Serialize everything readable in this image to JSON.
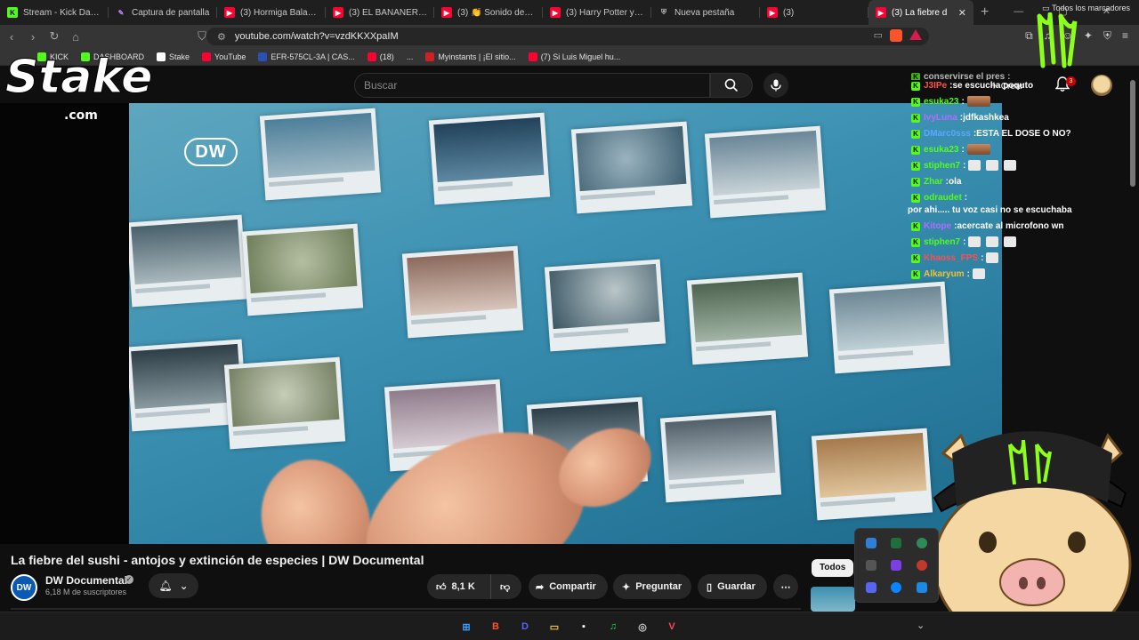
{
  "browser": {
    "tabs": [
      {
        "title": "Stream - Kick Dashbo",
        "icon": "kick-icon",
        "active": false
      },
      {
        "title": "Captura de pantalla",
        "icon": "pen-icon",
        "active": false
      },
      {
        "title": "(3) Hormiga Bala | Do",
        "icon": "youtube-icon",
        "active": false
      },
      {
        "title": "(3) EL BANANERO - I",
        "icon": "youtube-icon",
        "active": false
      },
      {
        "title": "(3) 👏 Sonido de ap",
        "icon": "youtube-icon",
        "active": false
      },
      {
        "title": "(3) Harry Potter y las",
        "icon": "youtube-icon",
        "active": false
      },
      {
        "title": "Nueva pestaña",
        "icon": "shield-icon",
        "active": false
      },
      {
        "title": "(3)",
        "icon": "youtube-icon",
        "active": false
      },
      {
        "title": "(3) La fiebre d",
        "icon": "youtube-icon",
        "active": true
      }
    ],
    "new_tab": "+",
    "url": "youtube.com/watch?v=vzdKKXXpaIM",
    "bookmarks": [
      {
        "label": "KICK",
        "color": "#53fc18"
      },
      {
        "label": "DASHBOARD",
        "color": "#53fc18"
      },
      {
        "label": "Stake",
        "color": "#ffffff"
      },
      {
        "label": "YouTube",
        "color": "#ff0033"
      },
      {
        "label": "EFR-575CL-3A | CAS...",
        "color": "#2a4fb5"
      },
      {
        "label": "(18)",
        "color": "#ff0033"
      },
      {
        "label": "...",
        "color": ""
      },
      {
        "label": "Myinstants | ¡El sitio...",
        "color": "#cc2222"
      },
      {
        "label": "(7) Si Luis Miguel hu...",
        "color": "#ff0033"
      }
    ],
    "all_bookmarks": "Todos los marcadores"
  },
  "youtube": {
    "search_placeholder": "Buscar",
    "create_label": "Crear",
    "notifications_count": "3",
    "video_title": "La fiebre del sushi - antojos y extinción de especies | DW Documental",
    "channel_name": "DW Documental",
    "channel_avatar_text": "DW",
    "subscribers": "6,18 M de suscriptores",
    "likes": "8,1 K",
    "share_label": "Compartir",
    "ask_label": "Preguntar",
    "save_label": "Guardar",
    "chip_all": "Todos",
    "video_watermark": "DW"
  },
  "overlays": {
    "stake_text": "Stake",
    "stake_sub": ".com"
  },
  "chat": [
    {
      "user": "conservirse el pres",
      "user_color": "#ffffff",
      "msg": "",
      "emotes": 0,
      "partial": true
    },
    {
      "user": "J3IPe",
      "user_color": "#ff4e4e",
      "msg": "se escucha poquto",
      "emotes": 0
    },
    {
      "user": "esuka23",
      "user_color": "#53fc18",
      "msg": "",
      "emotes": 1,
      "pic": true
    },
    {
      "user": "IvyLuna",
      "user_color": "#b46cff",
      "msg": "jdfkashkea",
      "emotes": 0
    },
    {
      "user": "DMarc0sss",
      "user_color": "#5aa7ff",
      "msg": "ESTA EL DOSE O NO?",
      "emotes": 0
    },
    {
      "user": "esuka23",
      "user_color": "#53fc18",
      "msg": "",
      "emotes": 1,
      "pic": true
    },
    {
      "user": "stiphen7",
      "user_color": "#53fc18",
      "msg": "",
      "emotes": 3
    },
    {
      "user": "Zhar",
      "user_color": "#53fc18",
      "msg": "ola",
      "emotes": 0
    },
    {
      "user": "odraudet",
      "user_color": "#53fc18",
      "msg": "por ahi..... tu voz casi no se escuchaba",
      "emotes": 0
    },
    {
      "user": "Kitope",
      "user_color": "#b46cff",
      "msg": "acercate al microfono wn",
      "emotes": 0
    },
    {
      "user": "stiphen7",
      "user_color": "#53fc18",
      "msg": "",
      "emotes": 3
    },
    {
      "user": "Khaoss_FPS",
      "user_color": "#ff4e4e",
      "msg": "",
      "emotes": 1
    },
    {
      "user": "Alkaryum",
      "user_color": "#f1c232",
      "msg": "",
      "emotes": 1
    }
  ],
  "taskbar": {
    "apps": [
      {
        "name": "windows-start-icon",
        "color": "#3aa0ff",
        "glyph": "⊞"
      },
      {
        "name": "brave-icon",
        "color": "#fb542b",
        "glyph": "B"
      },
      {
        "name": "discord-icon",
        "color": "#5865f2",
        "glyph": "D"
      },
      {
        "name": "file-explorer-icon",
        "color": "#f5c342",
        "glyph": "▭"
      },
      {
        "name": "app-icon",
        "color": "#ffffff",
        "glyph": "▪"
      },
      {
        "name": "spotify-icon",
        "color": "#1ed760",
        "glyph": "♫"
      },
      {
        "name": "obs-icon",
        "color": "#cccccc",
        "glyph": "◎"
      },
      {
        "name": "valorant-icon",
        "color": "#ff4655",
        "glyph": "V"
      }
    ]
  },
  "colors": {
    "accent_kick": "#53fc18",
    "youtube_red": "#ff0033",
    "monster_green": "#8cff1a"
  }
}
